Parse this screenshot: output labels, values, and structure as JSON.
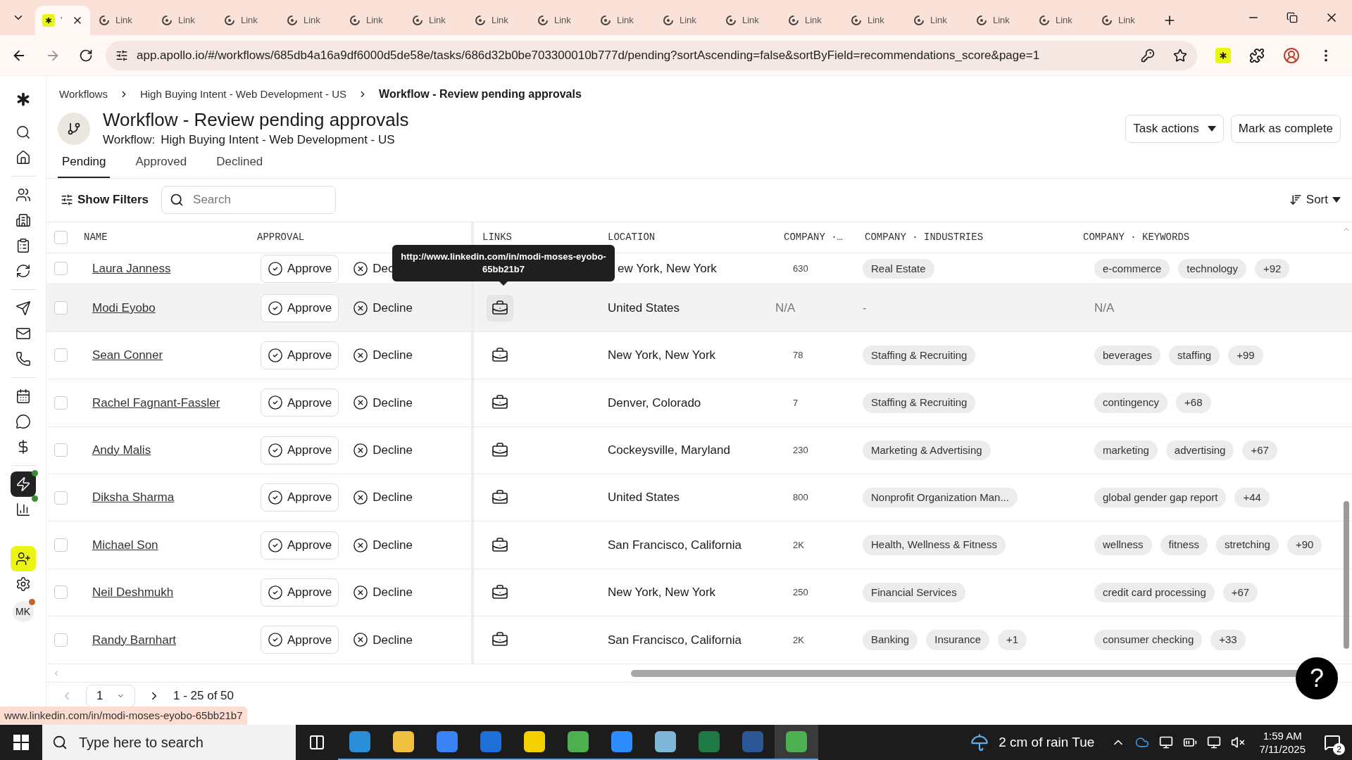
{
  "browser": {
    "tabs": [
      {
        "title": "'",
        "selected": true
      },
      {
        "title": "Link",
        "selected": false
      },
      {
        "title": "Link",
        "selected": false
      },
      {
        "title": "Link",
        "selected": false
      },
      {
        "title": "Link",
        "selected": false
      },
      {
        "title": "Link",
        "selected": false
      },
      {
        "title": "Link",
        "selected": false
      },
      {
        "title": "Link",
        "selected": false
      },
      {
        "title": "Link",
        "selected": false
      },
      {
        "title": "Link",
        "selected": false
      },
      {
        "title": "Link",
        "selected": false
      },
      {
        "title": "Link",
        "selected": false
      },
      {
        "title": "Link",
        "selected": false
      },
      {
        "title": "Link",
        "selected": false
      },
      {
        "title": "Link",
        "selected": false
      },
      {
        "title": "Link",
        "selected": false
      },
      {
        "title": "Link",
        "selected": false
      },
      {
        "title": "Link",
        "selected": false
      }
    ],
    "url": "app.apollo.io/#/workflows/685db4a16a9df6000d5de58e/tasks/686d32b0be703300010b777d/pending?sortAscending=false&sortByField=recommendations_score&page=1",
    "status_link": "www.linkedin.com/in/modi-moses-eyobo-65bb21b7"
  },
  "sidebar": {
    "items": [
      {
        "selected": false
      },
      {
        "selected": false
      },
      {
        "selected": false
      },
      {
        "selected": false
      },
      {
        "selected": false
      },
      {
        "selected": false
      },
      {
        "selected": false
      },
      {
        "selected": false
      },
      {
        "selected": false
      },
      {
        "selected": false
      },
      {
        "selected": false
      },
      {
        "selected": false
      },
      {
        "selected": true
      },
      {
        "selected": false
      },
      {
        "selected": false
      },
      {
        "selected": false
      }
    ],
    "avatar": "MK"
  },
  "breadcrumb": [
    "Workflows",
    "High Buying Intent - Web Development - US",
    "Workflow - Review pending approvals"
  ],
  "header": {
    "title": "Workflow - Review pending approvals",
    "subtitle_label": "Workflow:",
    "subtitle_value": "High Buying Intent - Web Development - US",
    "buttons": [
      {
        "label": "Task actions",
        "kind": "dropdown"
      },
      {
        "label": "Mark as complete",
        "kind": "plain"
      }
    ]
  },
  "tabs": [
    {
      "label": "Pending",
      "selected": true
    },
    {
      "label": "Approved",
      "selected": false
    },
    {
      "label": "Declined",
      "selected": false
    }
  ],
  "toolbar": {
    "filters": "Show Filters",
    "search": {
      "placeholder": "Search"
    },
    "sort": "Sort"
  },
  "table": {
    "columns": [
      "NAME",
      "APPROVAL",
      "LINKS",
      "LOCATION",
      "COMPANY ·…",
      "COMPANY · INDUSTRIES",
      "COMPANY · KEYWORDS"
    ],
    "all_checked": false,
    "rows": [
      {
        "name": "Laura Janness",
        "checked": false,
        "hovered": false,
        "approve": "Approve",
        "decline": "Dec",
        "link": false,
        "location": "ew York, New York",
        "company_size": "630",
        "industries": {
          "kind": "chips",
          "items": [
            "Real Estate"
          ]
        },
        "keywords": {
          "kind": "chips",
          "items": [
            "e-commerce",
            "technology",
            "+92"
          ]
        }
      },
      {
        "name": "Modi Eyobo",
        "checked": false,
        "hovered": true,
        "approve": "Approve",
        "decline": "Decline",
        "link": true,
        "location": "United States",
        "company_size": "N/A",
        "industries": {
          "kind": "text",
          "text": "-"
        },
        "keywords": {
          "kind": "text",
          "text": "N/A"
        }
      },
      {
        "name": "Sean Conner",
        "checked": false,
        "hovered": false,
        "approve": "Approve",
        "decline": "Decline",
        "link": true,
        "location": "New York, New York",
        "company_size": "78",
        "industries": {
          "kind": "chips",
          "items": [
            "Staffing & Recruiting"
          ]
        },
        "keywords": {
          "kind": "chips",
          "items": [
            "beverages",
            "staffing",
            "+99"
          ]
        }
      },
      {
        "name": "Rachel Fagnant-Fassler",
        "checked": false,
        "hovered": false,
        "approve": "Approve",
        "decline": "Decline",
        "link": true,
        "location": "Denver, Colorado",
        "company_size": "7",
        "industries": {
          "kind": "chips",
          "items": [
            "Staffing & Recruiting"
          ]
        },
        "keywords": {
          "kind": "chips",
          "items": [
            "contingency",
            "+68"
          ]
        }
      },
      {
        "name": "Andy Malis",
        "checked": false,
        "hovered": false,
        "approve": "Approve",
        "decline": "Decline",
        "link": true,
        "location": "Cockeysville, Maryland",
        "company_size": "230",
        "industries": {
          "kind": "chips",
          "items": [
            "Marketing & Advertising"
          ]
        },
        "keywords": {
          "kind": "chips",
          "items": [
            "marketing",
            "advertising",
            "+67"
          ]
        }
      },
      {
        "name": "Diksha Sharma",
        "checked": false,
        "hovered": false,
        "approve": "Approve",
        "decline": "Decline",
        "link": true,
        "location": "United States",
        "company_size": "800",
        "industries": {
          "kind": "chips",
          "items": [
            "Nonprofit Organization Man..."
          ]
        },
        "keywords": {
          "kind": "chips",
          "items": [
            "global gender gap report",
            "+44"
          ]
        }
      },
      {
        "name": "Michael Son",
        "checked": false,
        "hovered": false,
        "approve": "Approve",
        "decline": "Decline",
        "link": true,
        "location": "San Francisco, California",
        "company_size": "2K",
        "industries": {
          "kind": "chips",
          "items": [
            "Health, Wellness & Fitness"
          ]
        },
        "keywords": {
          "kind": "chips",
          "items": [
            "wellness",
            "fitness",
            "stretching",
            "+90"
          ]
        }
      },
      {
        "name": "Neil Deshmukh",
        "checked": false,
        "hovered": false,
        "approve": "Approve",
        "decline": "Decline",
        "link": true,
        "location": "New York, New York",
        "company_size": "250",
        "industries": {
          "kind": "chips",
          "items": [
            "Financial Services"
          ]
        },
        "keywords": {
          "kind": "chips",
          "items": [
            "credit card processing",
            "+67"
          ]
        }
      },
      {
        "name": "Randy Barnhart",
        "checked": false,
        "hovered": false,
        "approve": "Approve",
        "decline": "Decline",
        "link": true,
        "location": "San Francisco, California",
        "company_size": "2K",
        "industries": {
          "kind": "chips",
          "items": [
            "Banking",
            "Insurance",
            "+1"
          ]
        },
        "keywords": {
          "kind": "chips",
          "items": [
            "consumer checking",
            "+33"
          ]
        }
      }
    ]
  },
  "tooltip": "http://www.linkedin.com/in/modi-moses-eyobo-65bb21b7",
  "pagination": {
    "page": "1",
    "range": "1 - 25 of 50"
  },
  "help": "?",
  "taskbar": {
    "search_placeholder": "Type here to search",
    "weather": "2 cm of rain Tue",
    "time": "1:59 AM",
    "date": "7/11/2025",
    "notifications": "2"
  }
}
